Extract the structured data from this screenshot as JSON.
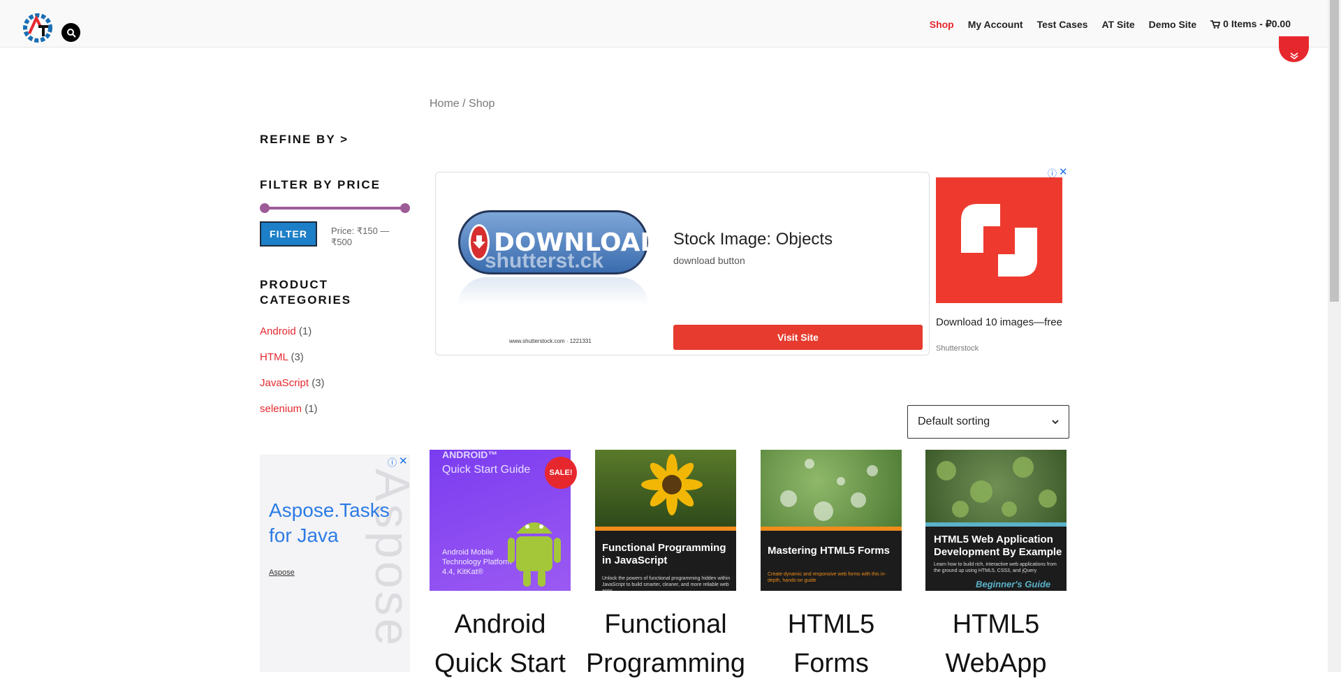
{
  "nav": {
    "items": [
      {
        "label": "Shop"
      },
      {
        "label": "My Account"
      },
      {
        "label": "Test Cases"
      },
      {
        "label": "AT Site"
      },
      {
        "label": "Demo Site"
      }
    ],
    "cart": "0 Items - ₽0.00"
  },
  "breadcrumb": {
    "home": "Home",
    "sep": " / ",
    "current": "Shop"
  },
  "sidebar": {
    "refine": "REFINE BY >",
    "filter_title": "FILTER BY PRICE",
    "filter_button": "FILTER",
    "price_label": "Price: ₹150 — ₹500",
    "categories_title_1": "PRODUCT",
    "categories_title_2": "CATEGORIES",
    "categories": [
      {
        "name": "Android",
        "count": "(1)"
      },
      {
        "name": "HTML",
        "count": "(3)"
      },
      {
        "name": "JavaScript",
        "count": "(3)"
      },
      {
        "name": "selenium",
        "count": "(1)"
      }
    ]
  },
  "ad_main": {
    "button_text": "DOWNLOAD",
    "watermark": "shutterst.ck",
    "site_url": "www.shutterstock.com · 1221331",
    "headline": "Stock Image: Objects",
    "subline": "download button",
    "visit_label": "Visit Site"
  },
  "ad_right": {
    "text": "Download 10 images—free",
    "brand": "Shutterstock"
  },
  "ad_side": {
    "title_1": "Aspose.Tasks",
    "title_2": "for Java",
    "brand": "Aspose",
    "watermark": "Aspose"
  },
  "sort": {
    "selected": "Default sorting"
  },
  "products": [
    {
      "title_1": "Android",
      "title_2": "Quick Start",
      "badge": "SALE!",
      "cover_1": "ANDROID™",
      "cover_2": "Quick Start Guide",
      "cover_3": "Android Mobile",
      "cover_4": "Technology Platform",
      "cover_5": "4.4, KitKat®"
    },
    {
      "title_1": "Functional",
      "title_2": "Programming",
      "cover_1": "Functional Programming",
      "cover_2": "in JavaScript",
      "cover_3": "Unlock the powers of functional programming hidden within JavaScript to build smarter, cleaner, and more reliable web apps"
    },
    {
      "title_1": "HTML5",
      "title_2": "Forms",
      "cover_1": "Mastering HTML5 Forms",
      "cover_3": "Create dynamic and responsive web forms with this in-depth, hands-on guide"
    },
    {
      "title_1": "HTML5",
      "title_2": "WebApp",
      "cover_1": "HTML5 Web Application",
      "cover_2": "Development By Example",
      "cover_3": "Learn how to build rich, interactive web applications from the ground up using HTML5, CSS3, and jQuery",
      "cover_4": "Beginner's Guide"
    }
  ],
  "colors": {
    "accent": "#e6282e",
    "filter_blue": "#1d7fc7",
    "slider": "#9d5c98"
  }
}
